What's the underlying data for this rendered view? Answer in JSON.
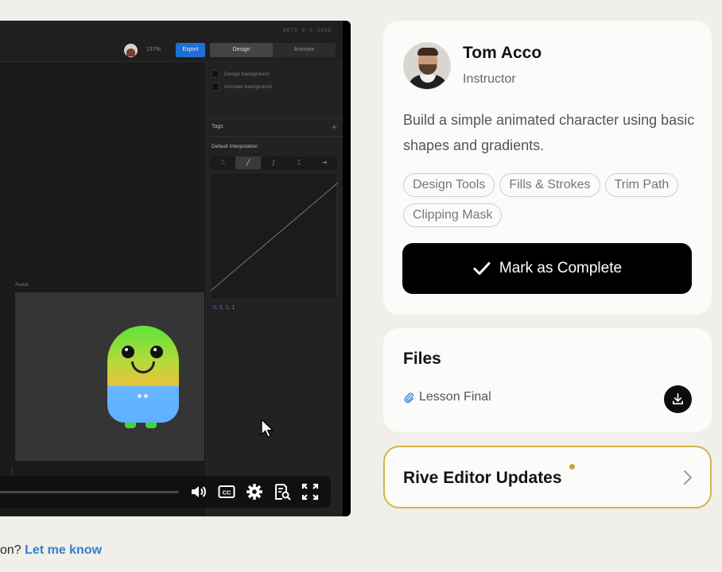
{
  "video": {
    "editor": {
      "version": "BETA 0.0.586b",
      "zoom": "137%",
      "export_label": "Export",
      "tabs": [
        {
          "label": "Design",
          "active": true
        },
        {
          "label": "Animate",
          "active": false
        }
      ],
      "panel": {
        "design_background": "Design background",
        "animate_background": "Animate background",
        "tags_label": "Tags",
        "interpolation_title": "Default Interpolation",
        "interpolation_values": "0, 0, 1, 1"
      },
      "artboard_label": "Avatar"
    },
    "progress": 0.0
  },
  "question": {
    "text": "on? ",
    "link": "Let me know"
  },
  "instructor": {
    "name": "Tom Acco",
    "role": "Instructor",
    "description": "Build a simple animated character using basic shapes and gradients.",
    "tags": [
      "Design Tools",
      "Fills & Strokes",
      "Trim Path",
      "Clipping Mask"
    ],
    "complete_label": "Mark as Complete"
  },
  "files": {
    "title": "Files",
    "items": [
      {
        "name": "Lesson Final"
      }
    ]
  },
  "updates": {
    "title": "Rive Editor Updates"
  },
  "colors": {
    "accent_blue": "#2f7fd6",
    "gold": "#d6b24a",
    "button_black": "#000000"
  }
}
